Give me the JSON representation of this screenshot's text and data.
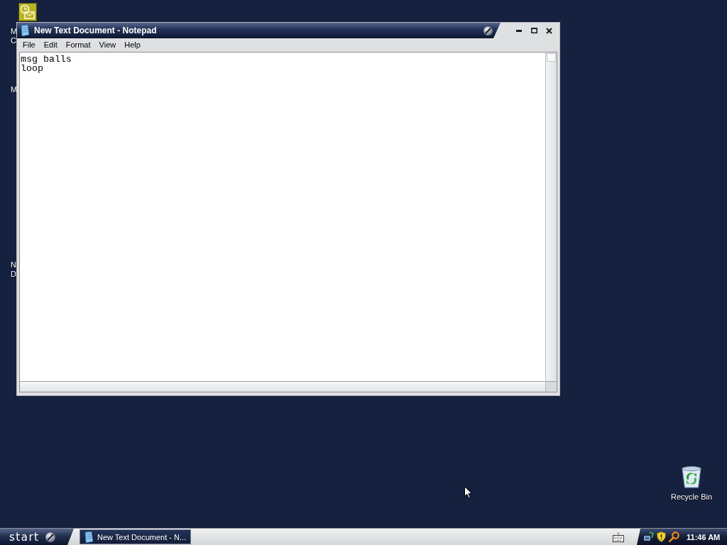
{
  "desktop": {
    "icons": [
      {
        "kind": "clock",
        "label": [
          "M",
          "C"
        ]
      },
      {
        "kind": "covered",
        "label": [
          "M"
        ]
      },
      {
        "kind": "covered",
        "label": [
          "N",
          "D"
        ]
      },
      {
        "kind": "bin",
        "label": [
          "Recycle Bin"
        ]
      }
    ]
  },
  "window": {
    "title": "New Text Document - Notepad",
    "menu": [
      "File",
      "Edit",
      "Format",
      "View",
      "Help"
    ],
    "text": [
      "msg balls",
      "loop"
    ]
  },
  "taskbar": {
    "start": "start",
    "tasks": [
      {
        "label": "New Text Document - N...",
        "selected": true
      }
    ],
    "clock": "11:46 AM"
  }
}
